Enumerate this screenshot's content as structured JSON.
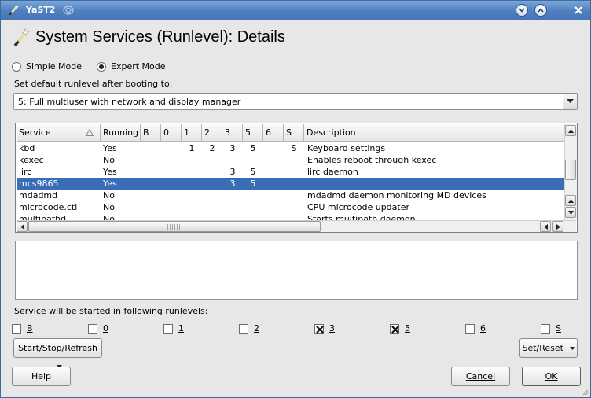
{
  "window": {
    "title": "YaST2"
  },
  "header": {
    "title": "System Services (Runlevel): Details"
  },
  "mode": {
    "simple_label": "Simple Mode",
    "expert_label": "Expert Mode",
    "selected": "expert"
  },
  "runlevel": {
    "label": "Set default runlevel after booting to:",
    "value": "5: Full multiuser with network and display manager"
  },
  "table": {
    "columns": [
      "Service",
      "Running",
      "B",
      "0",
      "1",
      "2",
      "3",
      "5",
      "6",
      "S",
      "Description"
    ],
    "rows": [
      {
        "service": "kbd",
        "running": "Yes",
        "b": "",
        "r0": "",
        "r1": "1",
        "r2": "2",
        "r3": "3",
        "r5": "5",
        "r6": "",
        "s": "S",
        "description": "Keyboard settings"
      },
      {
        "service": "kexec",
        "running": "No",
        "b": "",
        "r0": "",
        "r1": "",
        "r2": "",
        "r3": "",
        "r5": "",
        "r6": "",
        "s": "",
        "description": "Enables reboot through kexec"
      },
      {
        "service": "lirc",
        "running": "Yes",
        "b": "",
        "r0": "",
        "r1": "",
        "r2": "",
        "r3": "3",
        "r5": "5",
        "r6": "",
        "s": "",
        "description": "lirc daemon"
      },
      {
        "service": "mcs9865",
        "running": "Yes",
        "b": "",
        "r0": "",
        "r1": "",
        "r2": "",
        "r3": "3",
        "r5": "5",
        "r6": "",
        "s": "",
        "description": ""
      },
      {
        "service": "mdadmd",
        "running": "No",
        "b": "",
        "r0": "",
        "r1": "",
        "r2": "",
        "r3": "",
        "r5": "",
        "r6": "",
        "s": "",
        "description": "mdadmd daemon monitoring MD devices"
      },
      {
        "service": "microcode.ctl",
        "running": "No",
        "b": "",
        "r0": "",
        "r1": "",
        "r2": "",
        "r3": "",
        "r5": "",
        "r6": "",
        "s": "",
        "description": "CPU microcode updater"
      },
      {
        "service": "multipathd",
        "running": "No",
        "b": "",
        "r0": "",
        "r1": "",
        "r2": "",
        "r3": "",
        "r5": "",
        "r6": "",
        "s": "",
        "description": "Starts multipath daemon"
      }
    ],
    "selected_row": 3
  },
  "runlevels": {
    "label": "Service will be started in following runlevels:",
    "items": [
      {
        "label": "B",
        "checked": false
      },
      {
        "label": "0",
        "checked": false
      },
      {
        "label": "1",
        "checked": false
      },
      {
        "label": "2",
        "checked": false
      },
      {
        "label": "3",
        "checked": true
      },
      {
        "label": "5",
        "checked": true
      },
      {
        "label": "6",
        "checked": false
      },
      {
        "label": "S",
        "checked": false
      }
    ]
  },
  "buttons": {
    "start_stop": "Start/Stop/Refresh",
    "set_reset": "Set/Reset",
    "help": "Help",
    "cancel": "Cancel",
    "ok": "OK"
  },
  "colors": {
    "selection": "#3a6db8",
    "titlebar": "#4f7fbf"
  }
}
